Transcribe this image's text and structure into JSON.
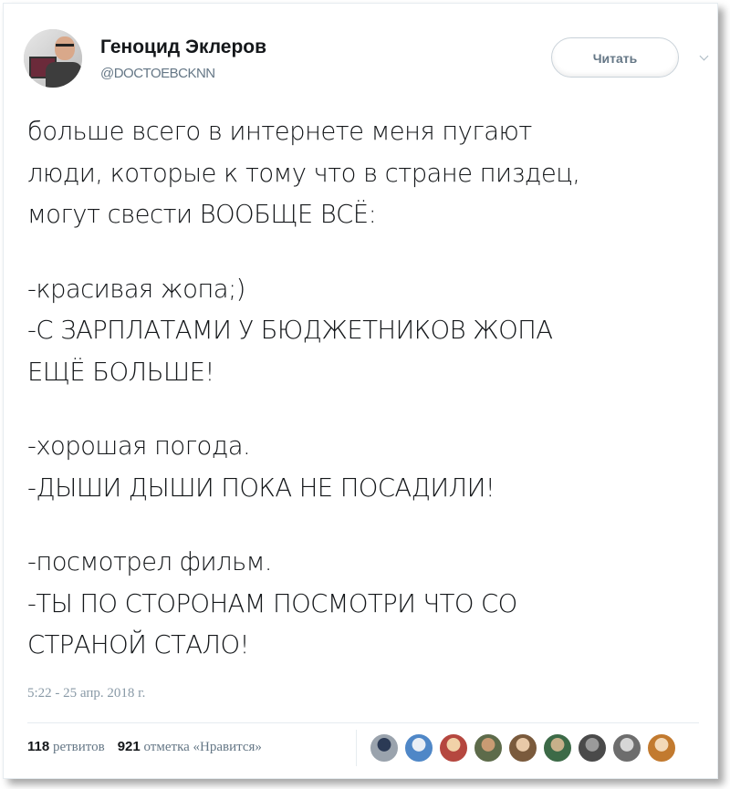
{
  "author": {
    "name": "Геноцид Эклеров",
    "handle": "@DOCTOEBCKNN"
  },
  "follow_button": {
    "label": "Читать"
  },
  "tweet": {
    "lines": [
      "больше всего в интернете меня пугают",
      "люди, которые к тому что в стране пиздец,",
      "могут свести ВООБЩЕ ВСЁ:",
      "",
      "-красивая жопа;)",
      "-С ЗАРПЛАТАМИ У БЮДЖЕТНИКОВ ЖОПА",
      "ЕЩЁ БОЛЬШЕ!",
      "",
      "-хорошая погода.",
      "-ДЫШИ ДЫШИ ПОКА НЕ ПОСАДИЛИ!",
      "",
      "-посмотрел фильм.",
      "-ТЫ ПО СТОРОНАМ ПОСМОТРИ ЧТО СО",
      "СТРАНОЙ СТАЛО!"
    ],
    "timestamp": "5:22 - 25 апр. 2018 г."
  },
  "stats": {
    "retweets_count": "118",
    "retweets_label": "ретвитов",
    "likes_count": "921",
    "likes_label": "отметка «Нравится»"
  },
  "liker_avatars": [
    {
      "name": "liker-avatar-1",
      "color": "#9aa3ad",
      "accent": "#2b3a55"
    },
    {
      "name": "liker-avatar-2",
      "color": "#4f87c7",
      "accent": "#e9eef5"
    },
    {
      "name": "liker-avatar-3",
      "color": "#b5473f",
      "accent": "#f1d2a8"
    },
    {
      "name": "liker-avatar-4",
      "color": "#5d6b4a",
      "accent": "#c99b73"
    },
    {
      "name": "liker-avatar-5",
      "color": "#7a5a3c",
      "accent": "#e8c9a8"
    },
    {
      "name": "liker-avatar-6",
      "color": "#3c6a47",
      "accent": "#c7b08a"
    },
    {
      "name": "liker-avatar-7",
      "color": "#4a4a4a",
      "accent": "#9a9a9a"
    },
    {
      "name": "liker-avatar-8",
      "color": "#6d6d6d",
      "accent": "#d6d6d6"
    },
    {
      "name": "liker-avatar-9",
      "color": "#c27a2f",
      "accent": "#f3d9b8"
    }
  ]
}
